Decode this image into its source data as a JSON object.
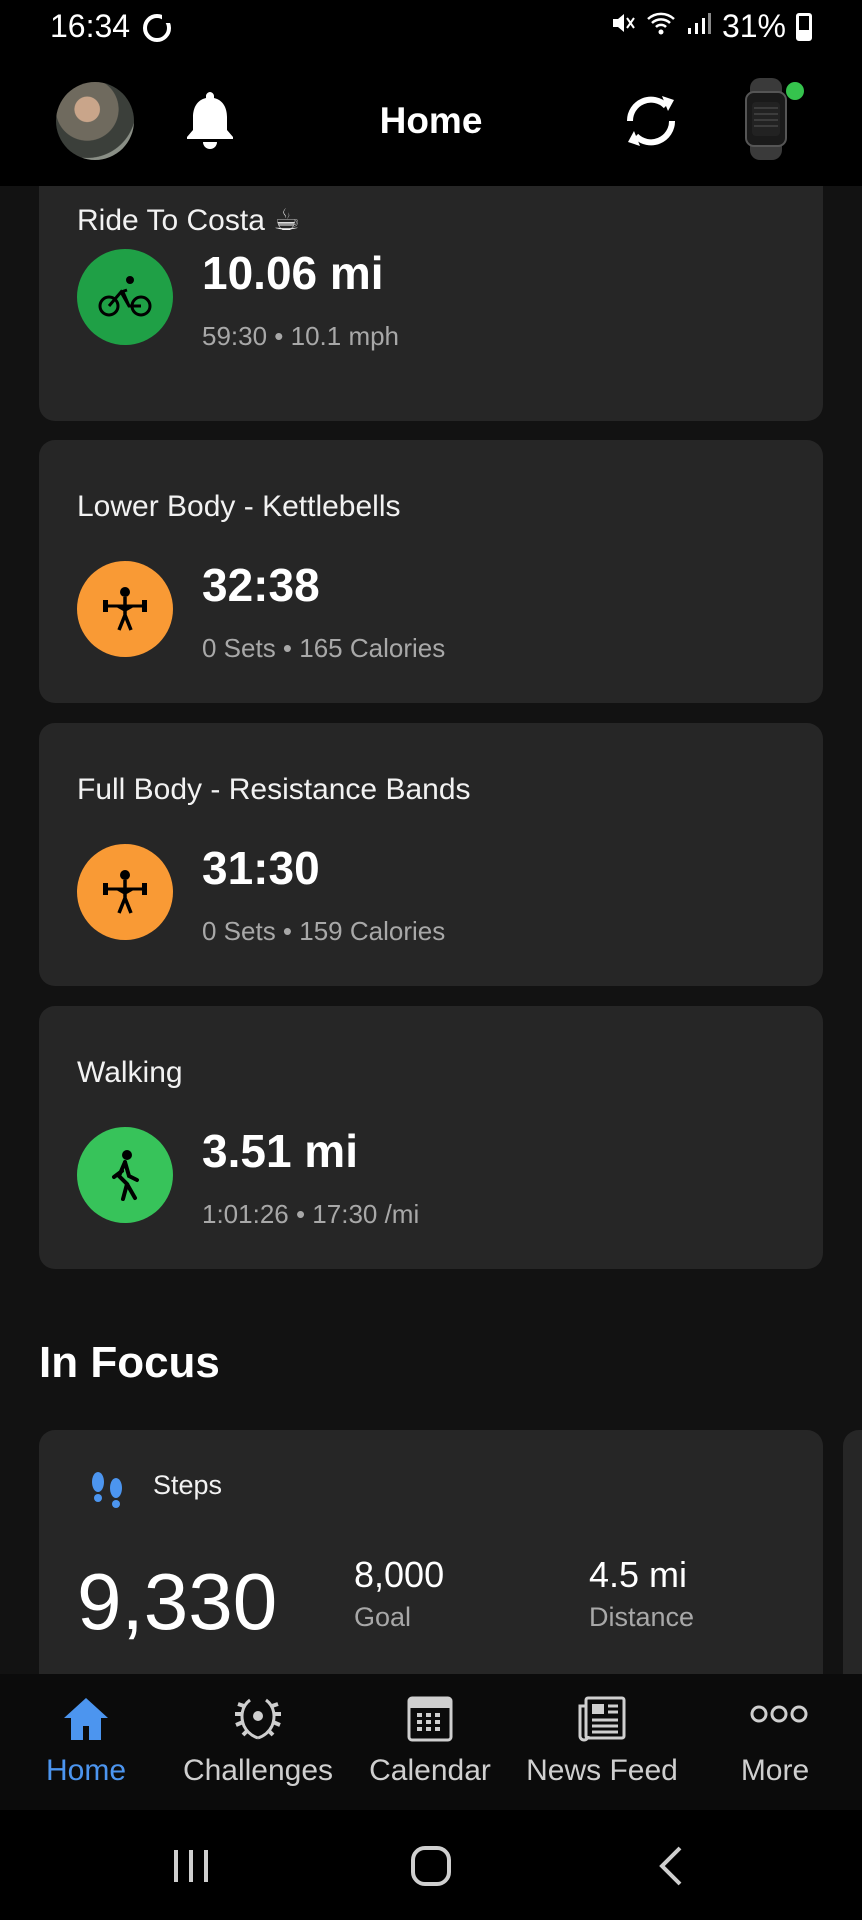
{
  "status_bar": {
    "time": "16:34",
    "battery": "31%"
  },
  "header": {
    "title": "Home"
  },
  "activities": [
    {
      "title": "Ride To Costa ☕",
      "main": "10.06 mi",
      "sub": "59:30 • 10.1 mph",
      "icon": "cycling-icon",
      "color": "#1fa046"
    },
    {
      "title": "Lower Body - Kettlebells",
      "main": "32:38",
      "sub": "0 Sets • 165 Calories",
      "icon": "weightlifting-icon",
      "color": "#f99a35"
    },
    {
      "title": "Full Body - Resistance Bands",
      "main": "31:30",
      "sub": "0 Sets • 159 Calories",
      "icon": "weightlifting-icon",
      "color": "#f99a35"
    },
    {
      "title": "Walking",
      "main": "3.51 mi",
      "sub": "1:01:26 • 17:30 /mi",
      "icon": "walking-icon",
      "color": "#37c35a"
    }
  ],
  "in_focus": {
    "title": "In Focus",
    "steps": {
      "label": "Steps",
      "value": "9,330",
      "goal_value": "8,000",
      "goal_label": "Goal",
      "distance_value": "4.5 mi",
      "distance_label": "Distance"
    }
  },
  "bottom_nav": [
    {
      "label": "Home",
      "active": true
    },
    {
      "label": "Challenges",
      "active": false
    },
    {
      "label": "Calendar",
      "active": false
    },
    {
      "label": "News Feed",
      "active": false
    },
    {
      "label": "More",
      "active": false
    }
  ],
  "colors": {
    "accent": "#4c95ef",
    "card": "#262626",
    "background": "#121212"
  }
}
